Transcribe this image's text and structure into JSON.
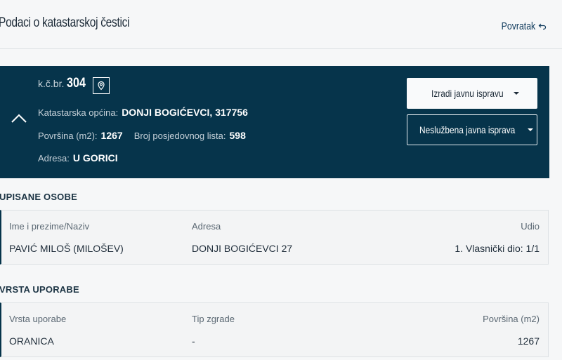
{
  "header": {
    "title": "Podaci o katastarskoj čestici",
    "back_label": "Povratak"
  },
  "parcel": {
    "kc_label": "k.č.br.",
    "kc_value": "304",
    "municipality_label": "Katastarska općina:",
    "municipality_value": "DONJI BOGIĆEVCI, 317756",
    "area_label": "Površina (m2):",
    "area_value": "1267",
    "sheet_label": "Broj posjedovnog lista:",
    "sheet_value": "598",
    "address_label": "Adresa:",
    "address_value": "U GORICI",
    "btn_public": "Izradi javnu ispravu",
    "btn_unofficial": "Neslužbena javna isprava"
  },
  "owners": {
    "title": "UPISANE OSOBE",
    "headers": [
      "Ime i prezime/Naziv",
      "Adresa",
      "Udio"
    ],
    "rows": [
      [
        "PAVIĆ MILOŠ (MILOŠEV)",
        "DONJI BOGIĆEVCI 27",
        "1. Vlasnički dio: 1/1"
      ]
    ]
  },
  "usage": {
    "title": "VRSTA UPORABE",
    "headers": [
      "Vrsta uporabe",
      "Tip zgrade",
      "Površina (m2)"
    ],
    "rows": [
      [
        "ORANICA",
        "-",
        "1267"
      ]
    ]
  },
  "colors": {
    "primary": "#06344b",
    "background": "#f6f7f8"
  },
  "icons": [
    "back-arrow-icon",
    "chevron-up-icon",
    "map-pin-icon",
    "caret-down-icon"
  ]
}
